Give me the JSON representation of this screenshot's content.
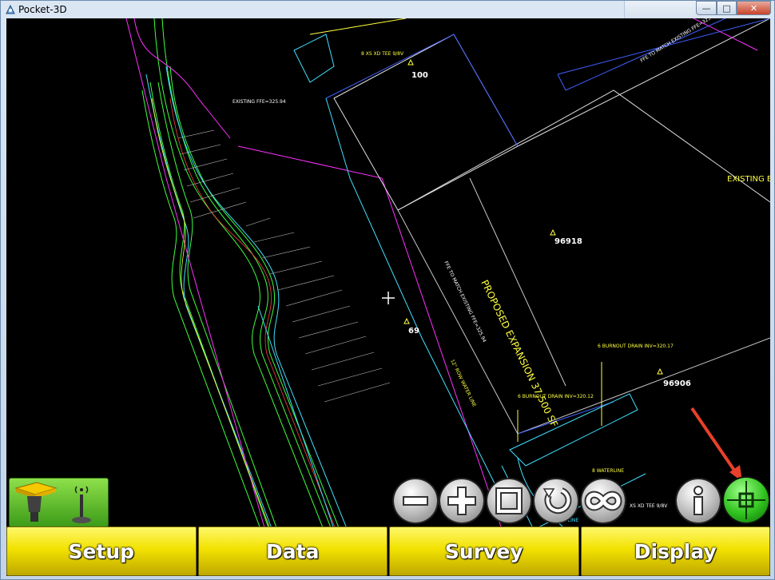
{
  "window": {
    "title": "Pocket-3D",
    "controls": {
      "minimize": "—",
      "maximize": "□",
      "close": "✕"
    }
  },
  "drawing": {
    "points": [
      {
        "label": "100"
      },
      {
        "label": "96918"
      },
      {
        "label": "69"
      },
      {
        "label": "96906"
      }
    ],
    "labels": {
      "existing_ffe": "EXISTING FFE=325.94",
      "existing_building": "EXISTING E",
      "ffe_match_top": "FFE TO MATCH EXISTING FFE=325.9",
      "ffe_match_mid": "FFE TO MATCH EXISTING FFE=325.94",
      "proposed_expansion": "PROPOSED EXPANSION  37,500 SF",
      "water_line": "12\" ROW WATER LINE",
      "tee": "8 XS XD  TEE  9/8V",
      "tee_bottom": "XS XD  TEE  9/8V",
      "burnout_drain": "6 BURNOUT DRAIN  INV=320.17",
      "burnout_drain_2": "6 BURNOUT DRAIN  INV=320.12",
      "waterline": "8 WATERLINE",
      "water_line_small": "WATER LINE"
    }
  },
  "toolbar": {
    "zoom_out_icon": "minus-icon",
    "zoom_in_icon": "plus-icon",
    "extents_icon": "square-icon",
    "rotate_icon": "rotate-icon",
    "link_icon": "infinity-icon",
    "info_icon": "info-icon",
    "gps_icon": "crosshair-icon"
  },
  "menu": {
    "setup": "Setup",
    "data": "Data",
    "survey": "Survey",
    "display": "Display"
  },
  "colors": {
    "canvas_bg": "#000000",
    "menu_yellow": "#f2e200",
    "gps_green": "#2fc21e",
    "annotation_arrow": "#e8402a"
  }
}
